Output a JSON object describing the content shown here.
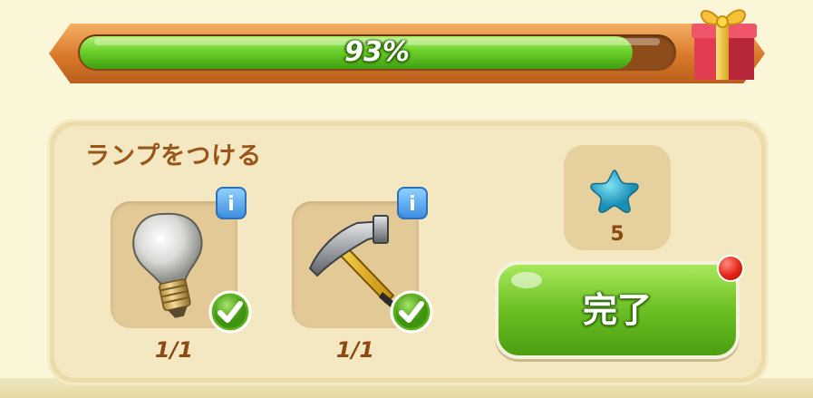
{
  "progress": {
    "percent_label": "93%",
    "value": 0.93,
    "fill_color": "#5cc21d",
    "frame_color": "#d9782a"
  },
  "reward_chest": {
    "icon": "gift-box-icon"
  },
  "task": {
    "title": "ランプをつける",
    "requirements": [
      {
        "item": "light-bulb",
        "icon": "light-bulb-icon",
        "count": "1/1",
        "complete": true,
        "info_label": "i"
      },
      {
        "item": "hammer",
        "icon": "hammer-icon",
        "count": "1/1",
        "complete": true,
        "info_label": "i"
      }
    ],
    "reward": {
      "icon": "blue-star-icon",
      "amount": "5"
    },
    "complete_button_label": "完了",
    "notification": true
  }
}
